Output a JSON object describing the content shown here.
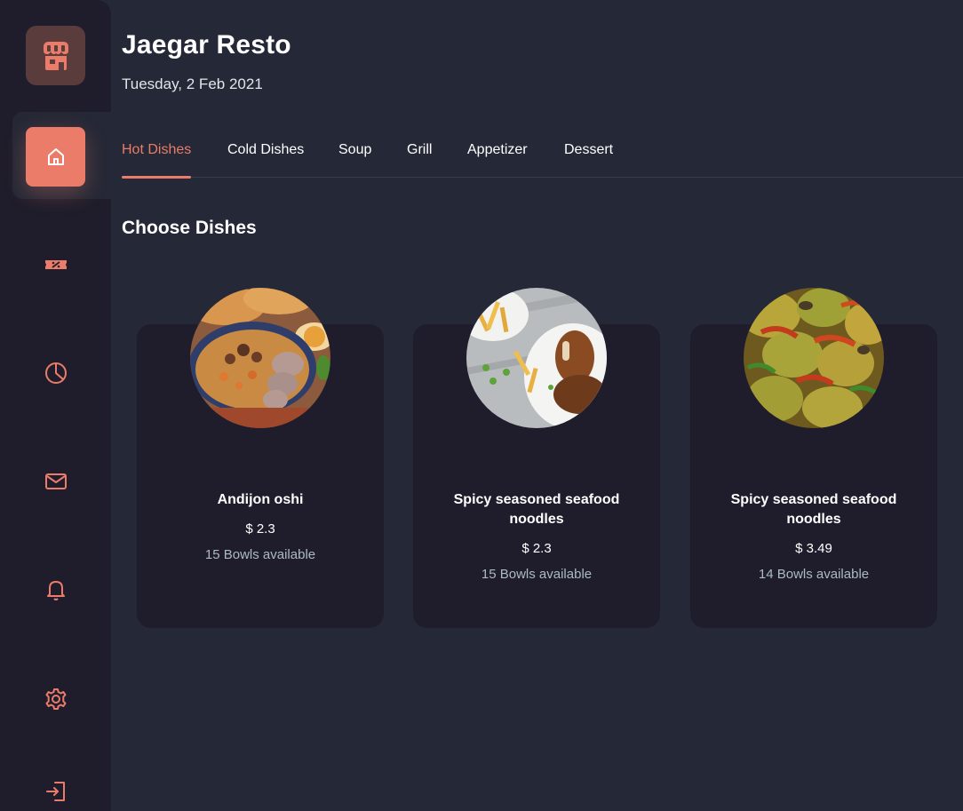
{
  "app": {
    "title": "Jaegar Resto",
    "date": "Tuesday, 2 Feb 2021"
  },
  "colors": {
    "accent": "#EA7C69",
    "sidebar": "#1F1D2B",
    "background": "#252836",
    "muted_text": "#ABBBC2"
  },
  "sidebar": {
    "logo_icon": "store-icon",
    "items": [
      {
        "icon": "home-icon",
        "active": true
      },
      {
        "icon": "discount-icon",
        "active": false
      },
      {
        "icon": "pie-chart-icon",
        "active": false
      },
      {
        "icon": "mail-icon",
        "active": false
      },
      {
        "icon": "bell-icon",
        "active": false
      },
      {
        "icon": "gear-icon",
        "active": false
      },
      {
        "icon": "logout-icon",
        "active": false
      }
    ]
  },
  "tabs": [
    {
      "label": "Hot Dishes",
      "active": true
    },
    {
      "label": "Cold Dishes",
      "active": false
    },
    {
      "label": "Soup",
      "active": false
    },
    {
      "label": "Grill",
      "active": false
    },
    {
      "label": "Appetizer",
      "active": false
    },
    {
      "label": "Dessert",
      "active": false
    }
  ],
  "section_title": "Choose Dishes",
  "dishes": [
    {
      "name": "Andijon oshi",
      "price": "$ 2.3",
      "availability": "15 Bowls available"
    },
    {
      "name": "Spicy seasoned seafood noodles",
      "price": "$ 2.3",
      "availability": "15 Bowls available"
    },
    {
      "name": "Spicy seasoned seafood noodles",
      "price": "$ 3.49",
      "availability": "14 Bowls available"
    }
  ]
}
